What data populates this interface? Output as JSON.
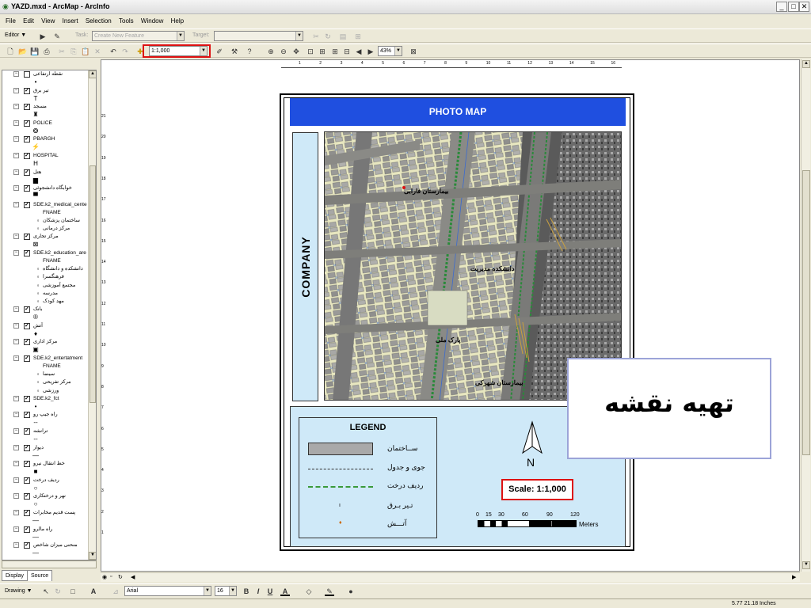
{
  "window": {
    "title": "YAZD.mxd - ArcMap - ArcInfo",
    "buttons": [
      "minimize",
      "maximize",
      "close"
    ]
  },
  "menu": [
    "File",
    "Edit",
    "View",
    "Insert",
    "Selection",
    "Tools",
    "Window",
    "Help"
  ],
  "editor_toolbar": {
    "editor_label": "Editor ▼",
    "task_label": "Task:",
    "task_value": "Create New Feature",
    "target_label": "Target:"
  },
  "standard_toolbar": {
    "scale_value": "1:1,000",
    "zoom_value": "43%"
  },
  "hruler_ticks": [
    "1",
    "2",
    "3",
    "4",
    "5",
    "6",
    "7",
    "8",
    "9",
    "10",
    "11",
    "12",
    "13",
    "14",
    "15",
    "16"
  ],
  "vruler_ticks": [
    "21",
    "20",
    "19",
    "18",
    "17",
    "16",
    "15",
    "14",
    "13",
    "12",
    "11",
    "10",
    "9",
    "8",
    "7",
    "6",
    "5",
    "4",
    "3",
    "2",
    "1"
  ],
  "toc": {
    "layers": [
      {
        "name": "نقطه ارتفاعی",
        "checked": false,
        "sym": "•"
      },
      {
        "name": "تیر برق",
        "checked": true,
        "sym": "T"
      },
      {
        "name": "مسجد",
        "checked": true,
        "sym": "♜"
      },
      {
        "name": "POLICE",
        "checked": true,
        "sym": "❂"
      },
      {
        "name": "PBARGH",
        "checked": true,
        "sym": "⚡"
      },
      {
        "name": "HOSPITAL",
        "checked": true,
        "sym": "H"
      },
      {
        "name": "هتل",
        "checked": true,
        "sym": "▆"
      },
      {
        "name": "خوابگاه دانشجوئی",
        "checked": true,
        "sym": "▀"
      },
      {
        "name": "SDE.k2_medical_cente",
        "checked": true,
        "sym": ""
      },
      {
        "name": "مرکز تجاری",
        "checked": true,
        "sym": "⊠"
      },
      {
        "name": "SDE.k2_education_are",
        "checked": true,
        "sym": ""
      },
      {
        "name": "بانک",
        "checked": true,
        "sym": "®"
      },
      {
        "name": "آتش",
        "checked": true,
        "sym": "♦"
      },
      {
        "name": "مرکز اداری",
        "checked": true,
        "sym": "▣"
      },
      {
        "name": "SDE.k2_entertatment",
        "checked": true,
        "sym": ""
      },
      {
        "name": "SDE.k2_fct",
        "checked": true,
        "sym": "•"
      },
      {
        "name": "راه جیپ رو",
        "checked": true,
        "sym": "--"
      },
      {
        "name": "ترانشه",
        "checked": true,
        "sym": "--"
      },
      {
        "name": "دیوار",
        "checked": true,
        "sym": "—"
      },
      {
        "name": "خط انتقال نیرو",
        "checked": true,
        "sym": "■"
      },
      {
        "name": "ردیف درخت",
        "checked": true,
        "sym": "○"
      },
      {
        "name": "نهر و درختکاری",
        "checked": true,
        "sym": "○"
      },
      {
        "name": "پست قدیم مخابرات",
        "checked": true,
        "sym": "—"
      },
      {
        "name": "راه مالرو",
        "checked": true,
        "sym": "—"
      },
      {
        "name": "منحنی میزان شاخص",
        "checked": true,
        "sym": "—"
      }
    ],
    "subitems": {
      "medical": [
        "FNAME",
        "ساختمان پزشکان",
        "مرکز درمانی"
      ],
      "education": [
        "FNAME",
        "دانشکده و دانشگاه",
        "فرهنگسرا",
        "مجتمع آموزشی",
        "مدرسه",
        "مهد کودک"
      ],
      "entertain": [
        "FNAME",
        "سینما",
        "مرکز تفریحی",
        "ورزشی"
      ]
    },
    "tabs": [
      "Display",
      "Source"
    ]
  },
  "layout": {
    "title": "PHOTO MAP",
    "side_label": "COMPANY",
    "legend_title": "LEGEND",
    "legend_items": [
      "ســاختمان",
      "جوی و جدول",
      "ردیف درخت",
      "تـیر بـرق",
      "آتـــش"
    ],
    "north_label": "N",
    "scale_text": "Scale: 1:1,000",
    "scalebar_labels": [
      "0",
      "15",
      "30",
      "60",
      "90",
      "120"
    ],
    "scalebar_unit": "Meters",
    "map_labels": [
      "بیمارستان فارابی",
      "دانشکده مدیریت",
      "پارک ملی",
      "بیمارستان شهرکی"
    ]
  },
  "callout": {
    "text": "تهیه نقشه"
  },
  "draw_toolbar": {
    "drawing_label": "Drawing ▼",
    "font_name": "Arial",
    "font_size": "16",
    "bold": "B",
    "italic": "I",
    "underline": "U"
  },
  "status": {
    "coords": "5.77  21.18 Inches"
  },
  "colors": {
    "title_bar_blue": "#1f4fe0",
    "panel_light_blue": "#cfe9f8",
    "highlight_red": "#d11111"
  }
}
